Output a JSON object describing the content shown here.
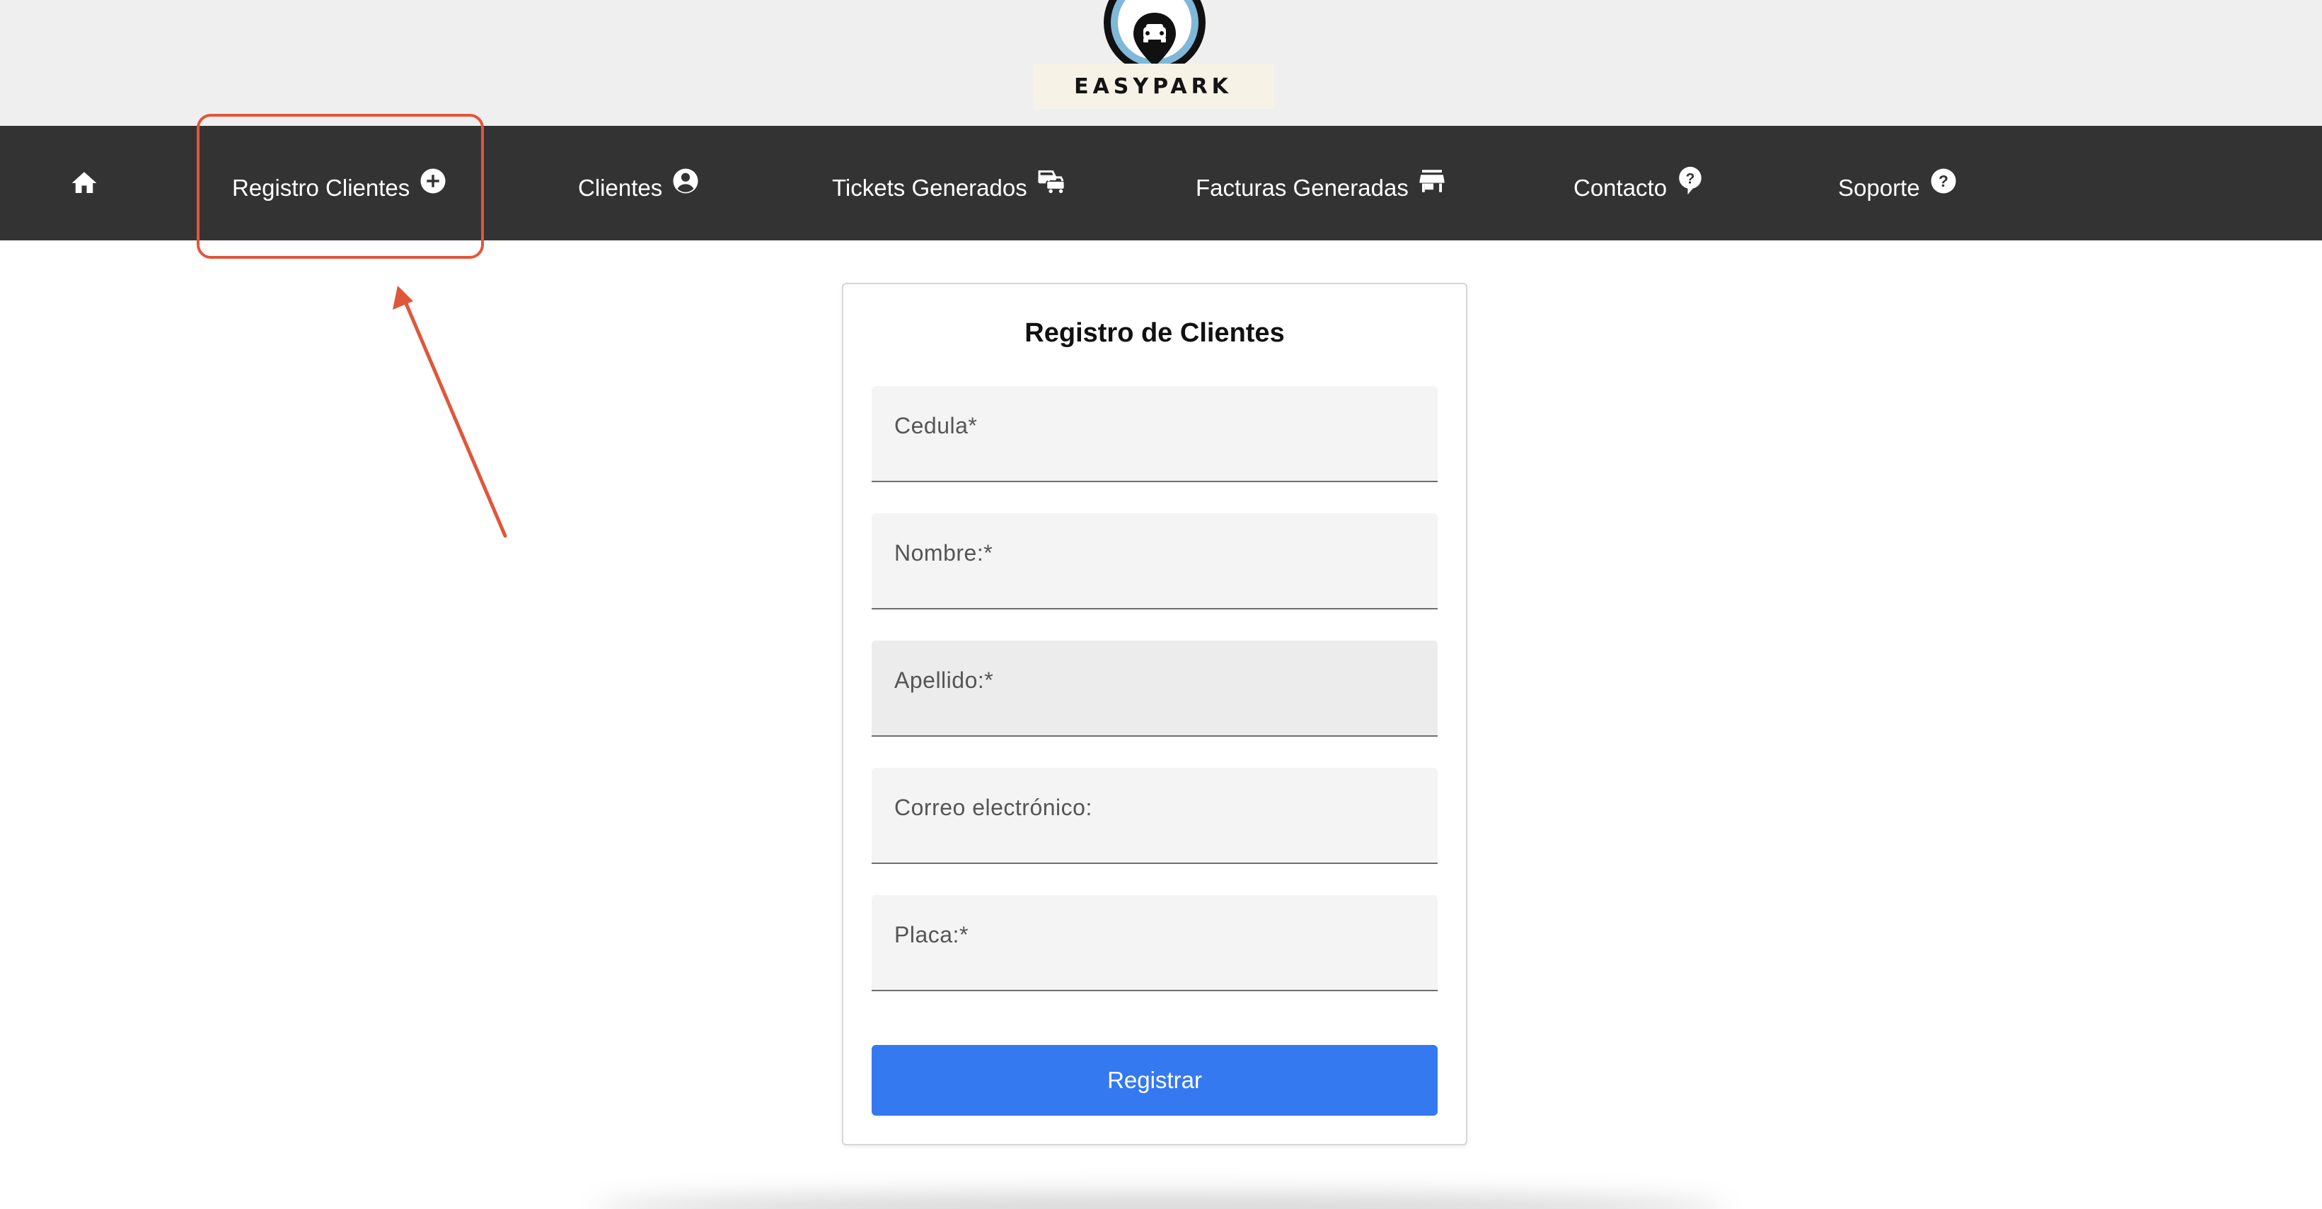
{
  "brand": {
    "name": "EASYPARK"
  },
  "nav": {
    "home_icon": "home-icon",
    "items": [
      {
        "label": "Registro Clientes",
        "icon": "plus-circle-icon"
      },
      {
        "label": "Clientes",
        "icon": "account-circle-icon"
      },
      {
        "label": "Tickets Generados",
        "icon": "cars-icon"
      },
      {
        "label": "Facturas Generadas",
        "icon": "store-icon"
      },
      {
        "label": "Contacto",
        "icon": "help-bubble-icon"
      },
      {
        "label": "Soporte",
        "icon": "help-circle-icon"
      }
    ]
  },
  "form": {
    "title": "Registro de Clientes",
    "fields": [
      {
        "label": "Cedula*",
        "value": ""
      },
      {
        "label": "Nombre:*",
        "value": ""
      },
      {
        "label": "Apellido:*",
        "value": ""
      },
      {
        "label": "Correo electrónico:",
        "value": ""
      },
      {
        "label": "Placa:*",
        "value": ""
      }
    ],
    "submit_label": "Registrar"
  },
  "colors": {
    "navbar": "#333333",
    "banner": "#efefef",
    "accent": "#3479f0",
    "annotation": "#e0563a"
  }
}
